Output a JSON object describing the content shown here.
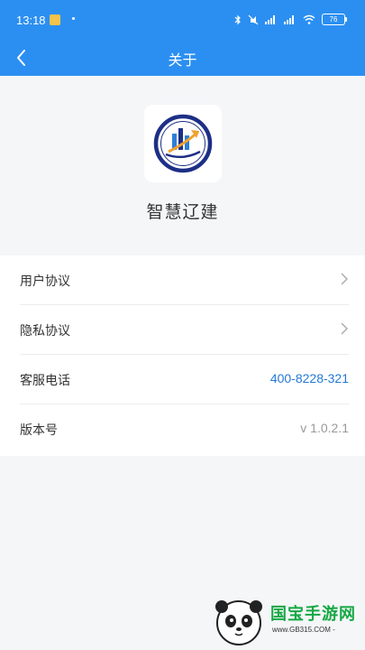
{
  "status_bar": {
    "time": "13:18",
    "battery": "76"
  },
  "nav": {
    "title": "关于"
  },
  "app": {
    "name": "智慧辽建"
  },
  "rows": [
    {
      "label": "用户协议"
    },
    {
      "label": "隐私协议"
    },
    {
      "label": "客服电话",
      "value": "400-8228-321"
    },
    {
      "label": "版本号",
      "value": "v 1.0.2.1"
    }
  ],
  "watermark": {
    "text": "国宝手游网",
    "url": "www.GB315.COM -"
  },
  "colors": {
    "primary": "#2b8ff2",
    "link": "#2579d6",
    "background": "#f5f6f8"
  }
}
